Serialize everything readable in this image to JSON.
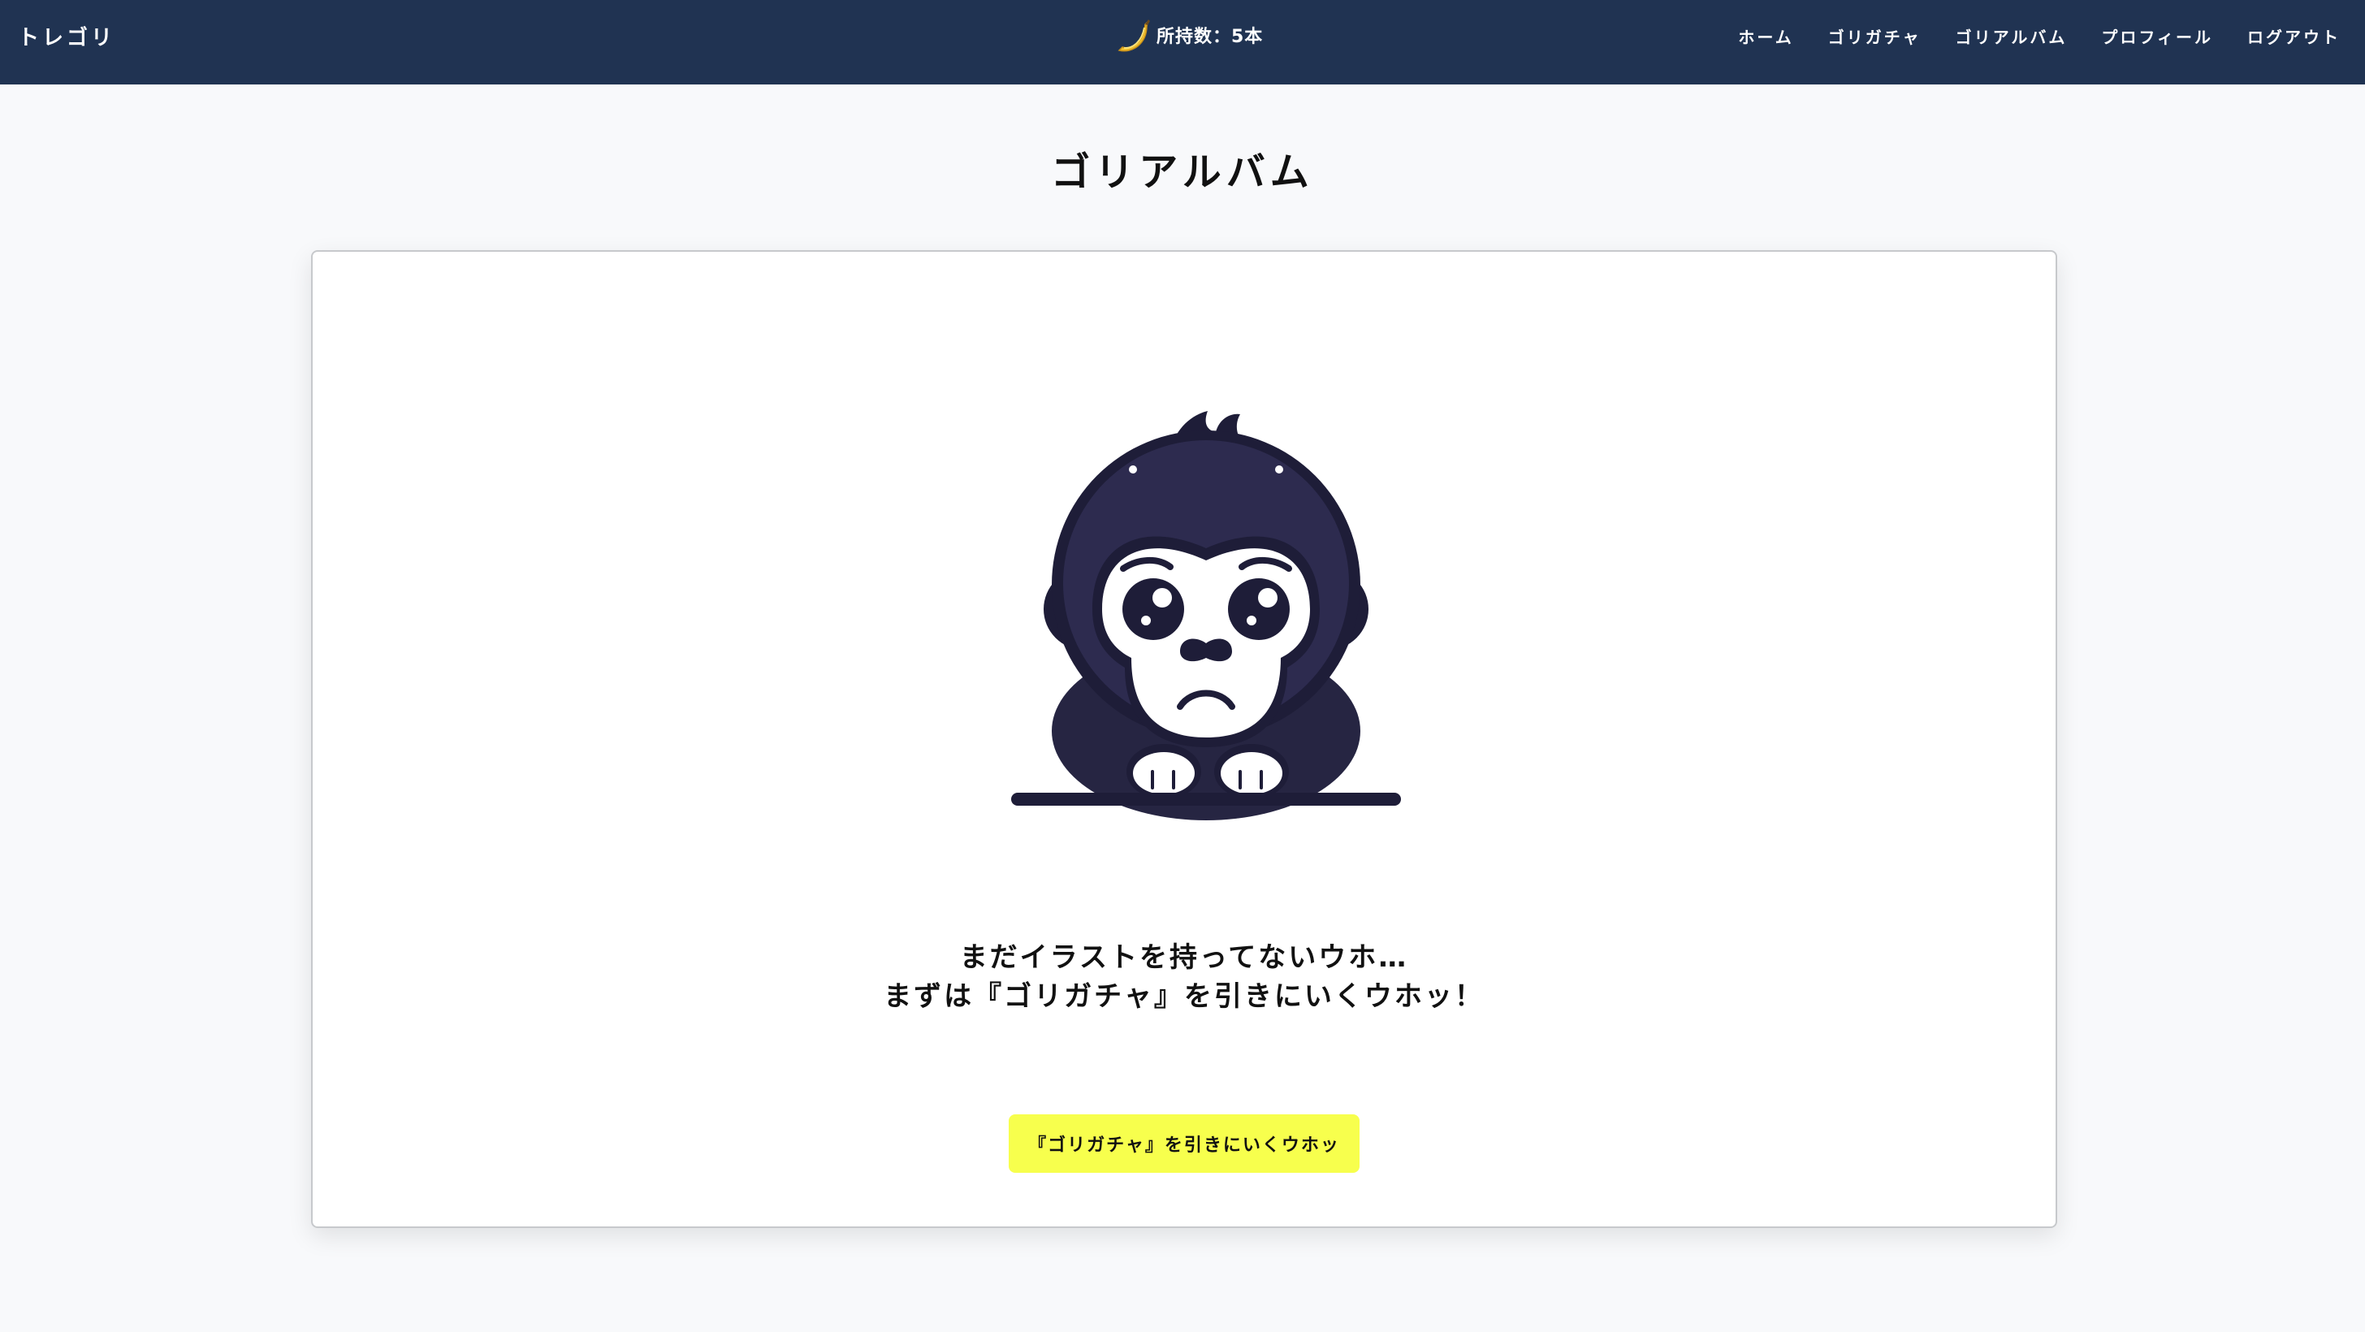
{
  "header": {
    "brand": "トレゴリ",
    "balance_label": "所持数：5本",
    "balance_icon": "banana-icon",
    "nav": [
      {
        "label": "ホーム"
      },
      {
        "label": "ゴリガチャ"
      },
      {
        "label": "ゴリアルバム"
      },
      {
        "label": "プロフィール"
      },
      {
        "label": "ログアウト"
      }
    ]
  },
  "main": {
    "title": "ゴリアルバム",
    "empty_state": {
      "illustration": "sad-gorilla-illustration",
      "message_line1": "まだイラストを持ってないウホ…",
      "message_line2": "まずは『ゴリガチャ』を引きにいくウホッ！",
      "button_label": "『ゴリガチャ』を引きにいくウホッ"
    }
  },
  "colors": {
    "header_bg": "#203352",
    "page_bg": "#f8f9fb",
    "button_bg": "#f7ff4d",
    "gorilla_dark": "#262542"
  }
}
